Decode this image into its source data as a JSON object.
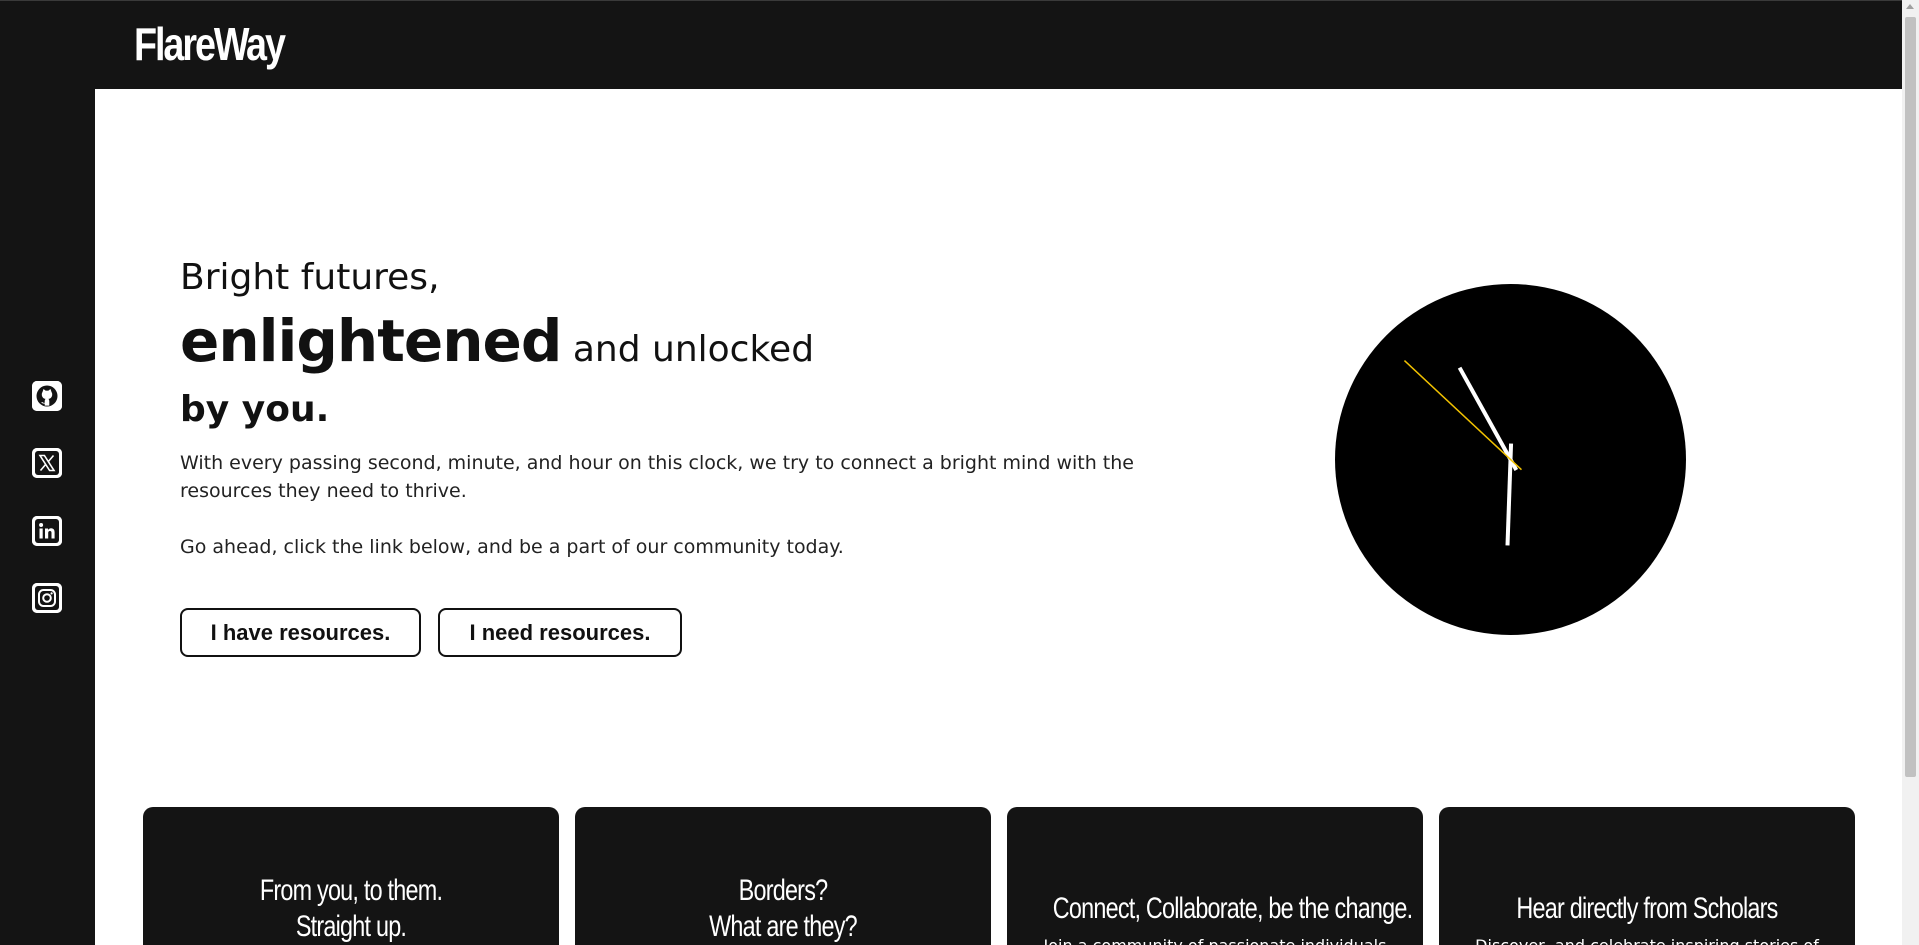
{
  "brand": {
    "name": "FlareWay"
  },
  "sidebar": {
    "items": [
      {
        "icon": "github-icon",
        "label": "GitHub"
      },
      {
        "icon": "x-icon",
        "label": "X"
      },
      {
        "icon": "linkedin-icon",
        "label": "LinkedIn"
      },
      {
        "icon": "instagram-icon",
        "label": "Instagram"
      }
    ]
  },
  "hero": {
    "line1": "Bright futures,",
    "line2_strong": "enlightened",
    "line2_rest": " and unlocked",
    "line3": "by you.",
    "description": "With every passing second, minute, and hour on this clock, we try to connect a bright mind with the resources they need to thrive.",
    "cta_text": "Go ahead, click the link below, and be a part of our community today.",
    "buttons": {
      "have": "I have resources.",
      "need": "I need resources."
    }
  },
  "clock": {
    "face_color": "#000000",
    "hand_color": "#ffffff",
    "second_hand_color": "#f2c200",
    "hour_angle_deg": 331,
    "minute_angle_deg": 182,
    "second_angle_deg": 313
  },
  "cards": [
    {
      "title_line1": "From you, to them.",
      "title_line2": "Straight up.",
      "subtitle": ""
    },
    {
      "title_line1": "Borders?",
      "title_line2": "What are they?",
      "subtitle": ""
    },
    {
      "title_line1": "Connect, Collaborate, be the change.",
      "title_line2": "",
      "subtitle": "Join a community of passionate individuals"
    },
    {
      "title_line1": "Hear directly from Scholars",
      "title_line2": "",
      "subtitle": "Discover, and celebrate inspiring stories of"
    }
  ],
  "colors": {
    "dark": "#141414",
    "light": "#ffffff",
    "accent": "#f2c200"
  }
}
